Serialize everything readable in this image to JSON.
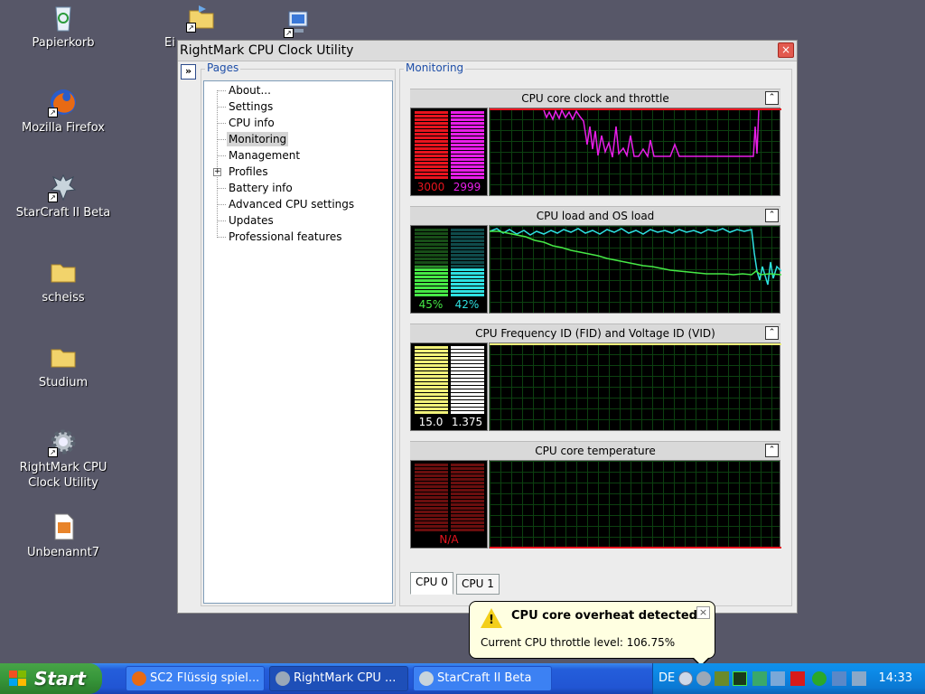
{
  "desktop": {
    "icons": [
      {
        "label": "Papierkorb",
        "name": "recycle-bin-icon"
      },
      {
        "label": "Mozilla Firefox",
        "name": "firefox-icon"
      },
      {
        "label": "StarCraft II Beta",
        "name": "starcraft-icon"
      },
      {
        "label": "scheiss",
        "name": "folder-icon"
      },
      {
        "label": "Studium",
        "name": "folder-icon"
      },
      {
        "label": "RightMark CPU Clock Utility",
        "name": "gear-icon"
      },
      {
        "label": "Unbenannt7",
        "name": "image-file-icon"
      },
      {
        "label": "Ei",
        "name": "folder-shortcut-icon"
      }
    ]
  },
  "window": {
    "title": "RightMark CPU Clock Utility",
    "close": "×",
    "toggle": "»"
  },
  "pages": {
    "legend": "Pages",
    "items": [
      "About...",
      "Settings",
      "CPU info",
      "Monitoring",
      "Management",
      "Profiles",
      "Battery info",
      "Advanced CPU settings",
      "Updates",
      "Professional features"
    ],
    "selected": "Monitoring",
    "expander": "+"
  },
  "monitoring": {
    "legend": "Monitoring",
    "collapse": "⌃",
    "panels": [
      {
        "title": "CPU core clock and throttle",
        "values": [
          "3000",
          "2999"
        ],
        "colors": [
          "#e8141e",
          "#e81ee8"
        ],
        "levels": [
          1.0,
          1.0
        ]
      },
      {
        "title": "CPU load and OS load",
        "values": [
          "45%",
          "42%"
        ],
        "colors": [
          "#46e846",
          "#2ee0e0"
        ],
        "levels": [
          0.45,
          0.42
        ]
      },
      {
        "title": "CPU Frequency ID (FID) and Voltage ID (VID)",
        "values": [
          "15.0",
          "1.375"
        ],
        "colors": [
          "#f2f27a",
          "#ffffff"
        ],
        "levels": [
          1.0,
          1.0
        ]
      },
      {
        "title": "CPU core temperature",
        "values": [
          "N/A"
        ],
        "colors": [
          "#6a0e0e",
          "#6a0e0e"
        ],
        "levels": [
          1.0,
          1.0
        ]
      }
    ],
    "tabs": [
      "CPU 0",
      "CPU 1"
    ]
  },
  "balloon": {
    "title": "CPU core overheat detected",
    "text": "Current CPU throttle level: 106.75%",
    "close": "×",
    "warn": "!"
  },
  "taskbar": {
    "start": "Start",
    "buttons": [
      "SC2 Flüssig spiel...",
      "RightMark CPU ...",
      "StarCraft II Beta"
    ],
    "lang": "DE",
    "clock": "14:33"
  }
}
